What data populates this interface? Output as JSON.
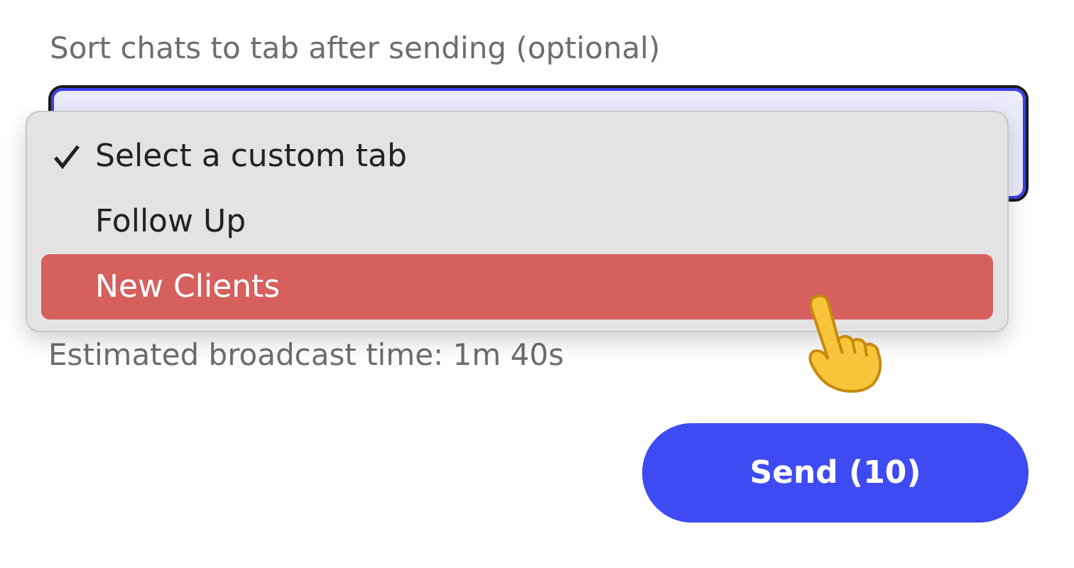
{
  "label": "Sort chats to tab after sending (optional)",
  "menu": {
    "items": [
      {
        "label": "Select a custom tab",
        "checked": true,
        "highlighted": false
      },
      {
        "label": "Follow Up",
        "checked": false,
        "highlighted": false
      },
      {
        "label": "New Clients",
        "checked": false,
        "highlighted": true
      }
    ]
  },
  "estimate": "Estimated broadcast time: 1m 40s",
  "send_button": "Send (10)"
}
